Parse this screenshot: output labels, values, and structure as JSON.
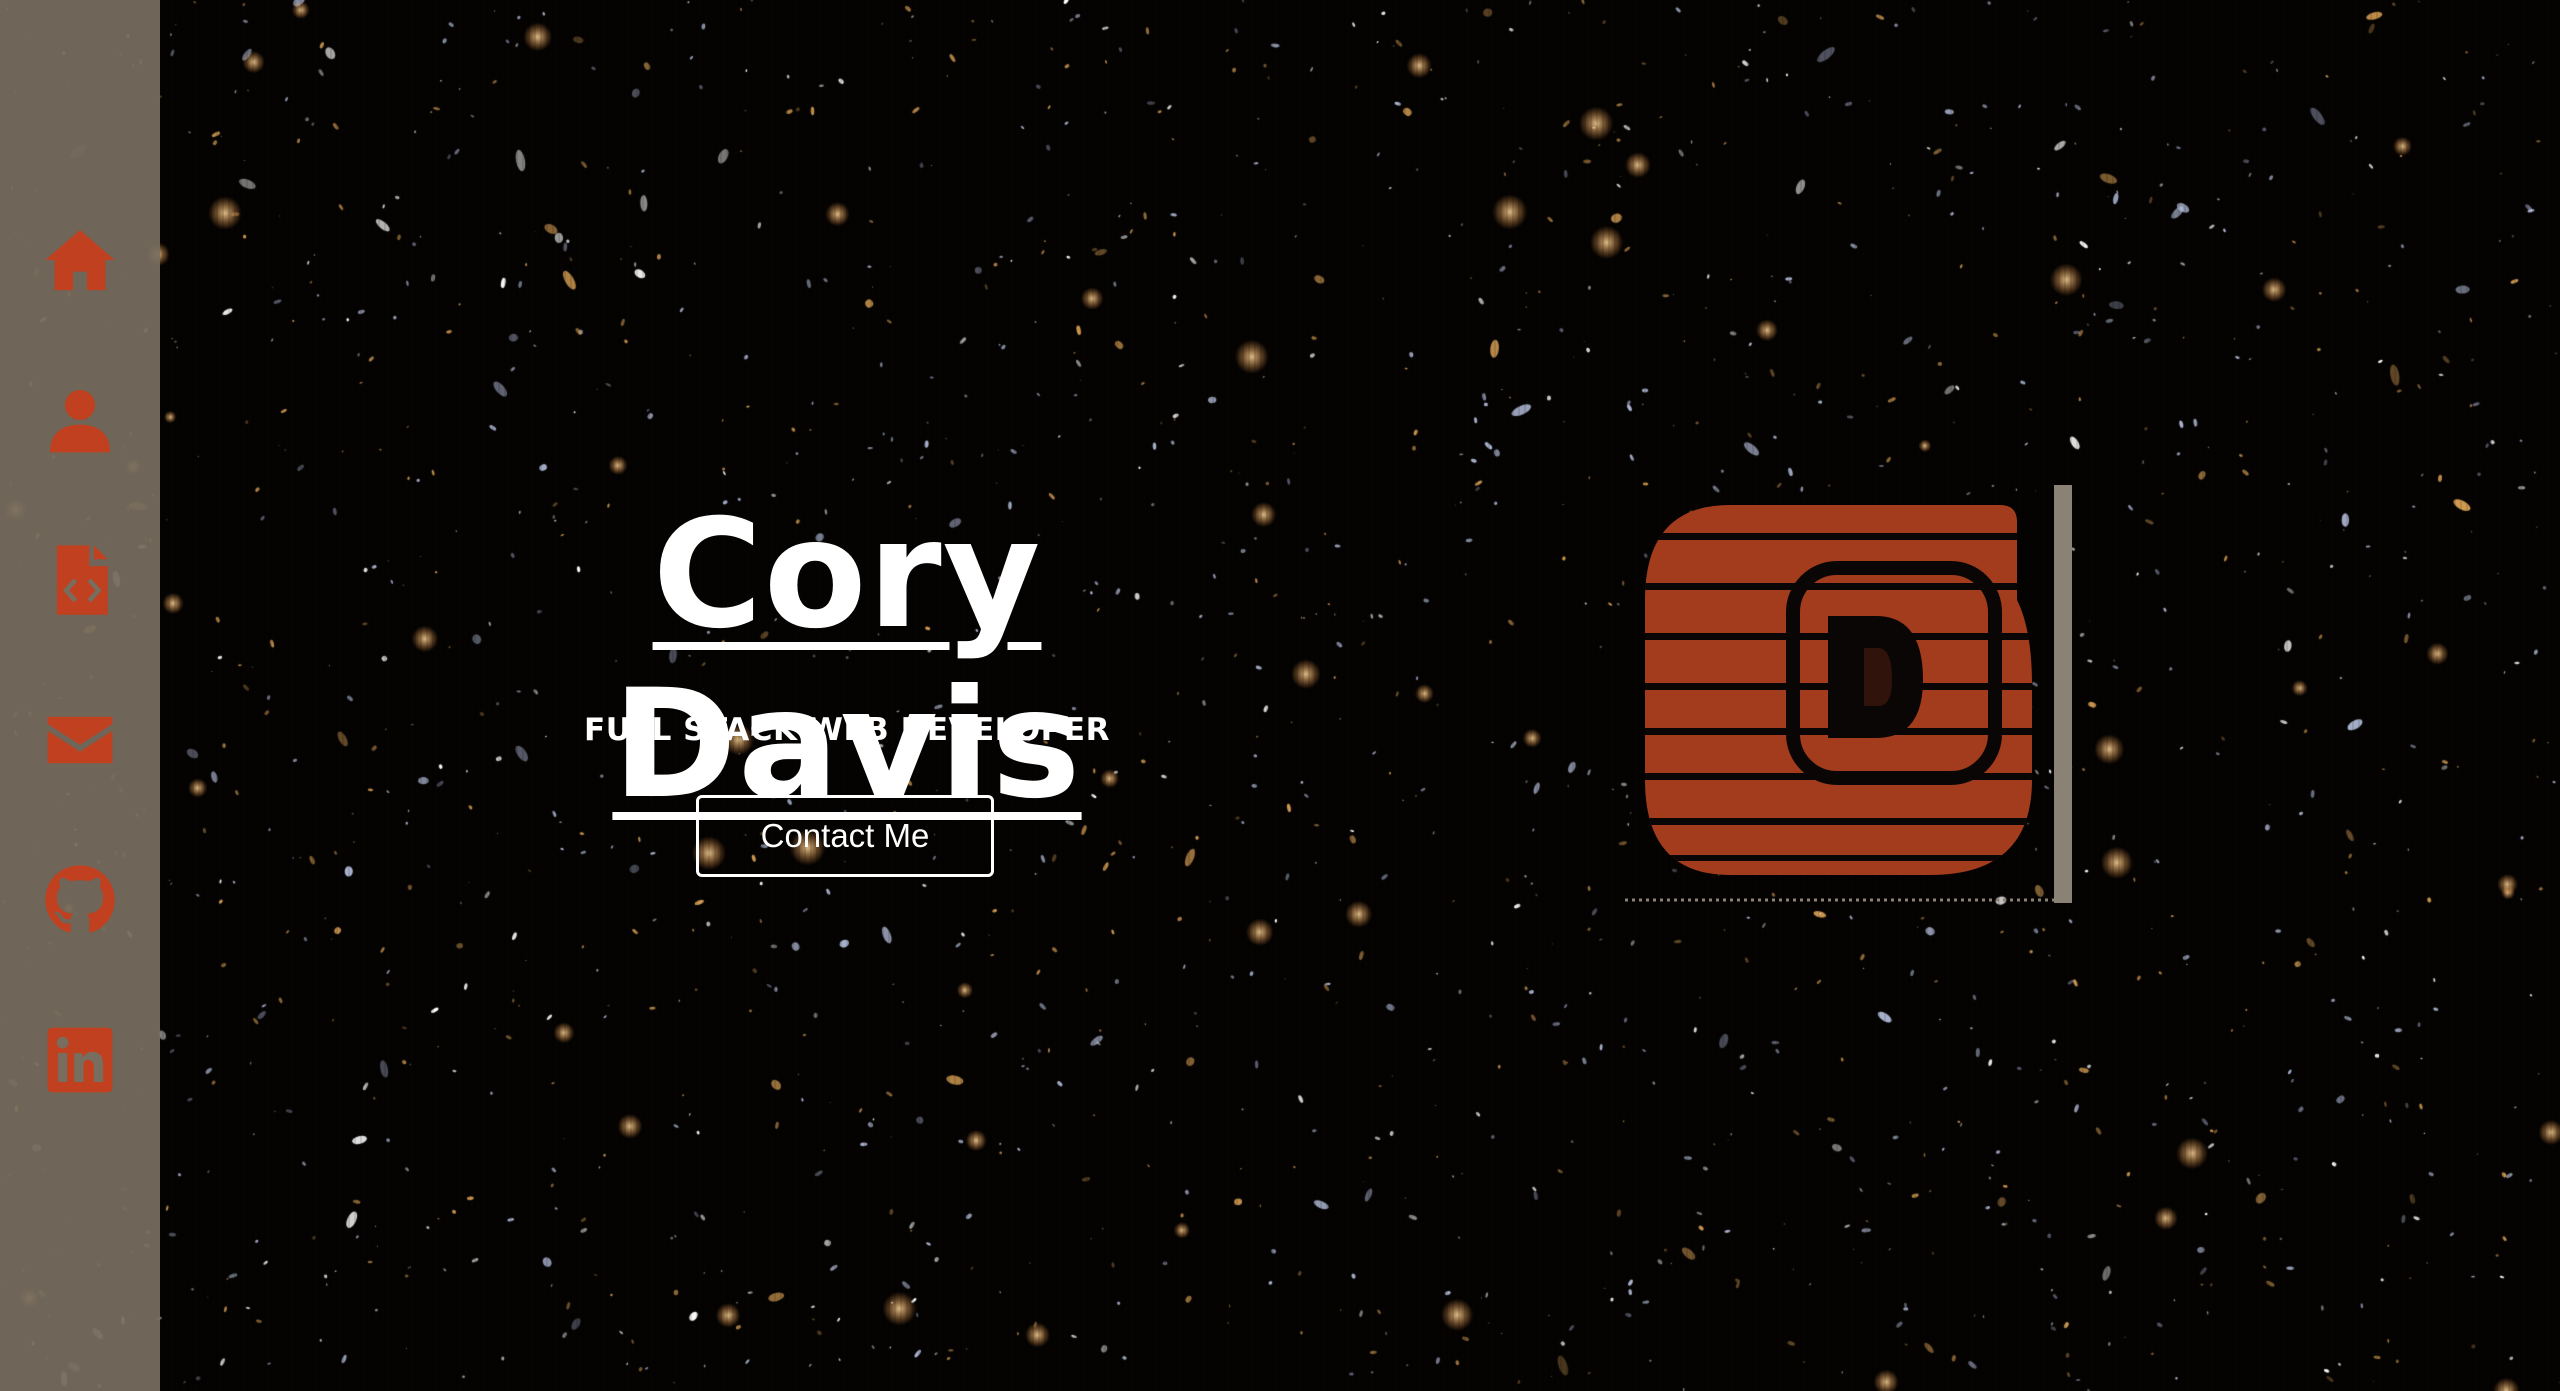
{
  "hero": {
    "name": "Cory Davis",
    "subtitle": "FULL STACK WEB DEVELOPER",
    "contact_label": "Contact Me"
  },
  "sidebar": {
    "items": [
      {
        "id": "home",
        "icon": "home-icon"
      },
      {
        "id": "about",
        "icon": "user-icon"
      },
      {
        "id": "portfolio",
        "icon": "code-file-icon"
      },
      {
        "id": "contact",
        "icon": "envelope-icon"
      },
      {
        "id": "github",
        "icon": "github-icon"
      },
      {
        "id": "linkedin",
        "icon": "linkedin-icon"
      }
    ]
  },
  "logo": {
    "letter": "D",
    "icon": "cd-monogram-logo"
  },
  "colors": {
    "accent": "#c1401f",
    "sidebar_bg": "#786e5f",
    "logo_fill": "#a33c1c",
    "text": "#ffffff",
    "background": "#050403"
  }
}
